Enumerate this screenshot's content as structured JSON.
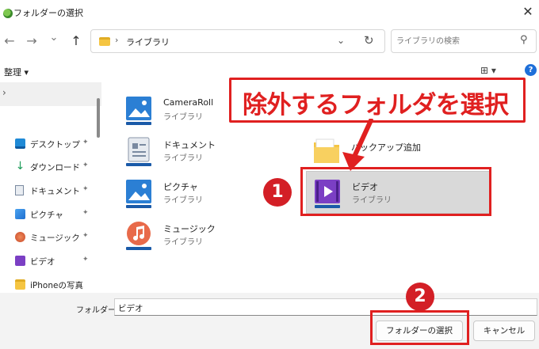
{
  "window": {
    "title": "フォルダーの選択",
    "close_glyph": "✕"
  },
  "nav": {
    "back_glyph": "←",
    "forward_glyph": "→",
    "recent_glyph": "⌄",
    "up_glyph": "↑",
    "address_separator": "›",
    "address_path": "ライブラリ",
    "address_chevron": "⌄",
    "refresh_glyph": "↻",
    "search_placeholder": "ライブラリの検索",
    "search_glyph": "⚲"
  },
  "toolbar": {
    "organize_label": "整理 ▾",
    "view_label": "⊞ ▾",
    "help_label": "?"
  },
  "sidebar": {
    "expander_glyph": "›",
    "pin_glyph": "📌",
    "items": [
      {
        "label": "デスクトップ",
        "pinned": true,
        "icon": "desktop-icon",
        "color": "#1f8ad6"
      },
      {
        "label": "ダウンロード",
        "pinned": true,
        "icon": "download-icon",
        "color": "#1e9c5a"
      },
      {
        "label": "ドキュメント",
        "pinned": true,
        "icon": "document-icon",
        "color": "#7a8aa0"
      },
      {
        "label": "ピクチャ",
        "pinned": true,
        "icon": "picture-icon",
        "color": "#1f7ad6"
      },
      {
        "label": "ミュージック",
        "pinned": true,
        "icon": "music-icon",
        "color": "#e06040"
      },
      {
        "label": "ビデオ",
        "pinned": true,
        "icon": "video-icon",
        "color": "#7b3fc4"
      },
      {
        "label": "iPhoneの写真",
        "pinned": false,
        "icon": "folder-icon",
        "color": "#f5c542"
      }
    ]
  },
  "libraries": [
    {
      "name": "CameraRoll",
      "sub": "ライブラリ",
      "icon": "camera-roll-icon"
    },
    {
      "name": "ドキュメント",
      "sub": "ライブラリ",
      "icon": "documents-library-icon"
    },
    {
      "name": "ピクチャ",
      "sub": "ライブラリ",
      "icon": "pictures-library-icon"
    },
    {
      "name": "ミュージック",
      "sub": "ライブラリ",
      "icon": "music-library-icon"
    },
    {
      "name": "バックアップ追加",
      "sub": "",
      "icon": "backup-folder-icon"
    },
    {
      "name": "ビデオ",
      "sub": "ライブラリ",
      "icon": "video-library-icon",
      "selected": true
    }
  ],
  "annotation": {
    "title": "除外するフォルダを選択",
    "badge1": "1",
    "badge2": "2",
    "color": "#e02020"
  },
  "footer": {
    "folder_label": "フォルダー:",
    "folder_value": "ビデオ",
    "select_button": "フォルダーの選択",
    "cancel_button": "キャンセル"
  }
}
